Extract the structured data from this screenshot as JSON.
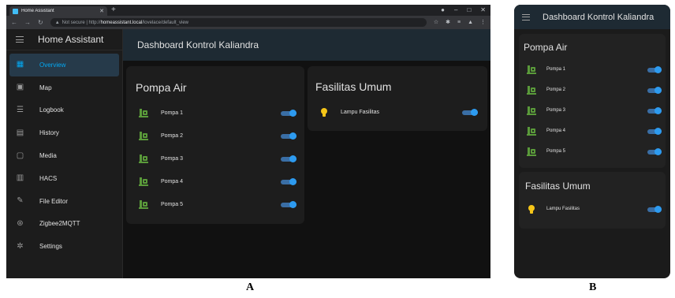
{
  "browser": {
    "tab_title": "Home Assistant",
    "url_scheme": "Not secure | http://",
    "url_host": "homeassistant.local",
    "url_path": "/lovelace/default_view"
  },
  "sidebar": {
    "app_title": "Home Assistant",
    "items": [
      {
        "label": "Overview",
        "icon": "view-dashboard-icon",
        "active": true
      },
      {
        "label": "Map",
        "icon": "map-icon"
      },
      {
        "label": "Logbook",
        "icon": "logbook-icon"
      },
      {
        "label": "History",
        "icon": "history-chart-icon"
      },
      {
        "label": "Media",
        "icon": "media-icon"
      },
      {
        "label": "HACS",
        "icon": "hacs-store-icon"
      },
      {
        "label": "File Editor",
        "icon": "wrench-icon"
      },
      {
        "label": "Zigbee2MQTT",
        "icon": "zigbee-icon"
      },
      {
        "label": "Settings",
        "icon": "gear-icon"
      }
    ]
  },
  "dashboard": {
    "title": "Dashboard Kontrol Kaliandra",
    "pompa_card": {
      "title": "Pompa Air",
      "rows": [
        "Pompa 1",
        "Pompa 2",
        "Pompa 3",
        "Pompa 4",
        "Pompa 5"
      ]
    },
    "fasilitas_card": {
      "title": "Fasilitas Umum",
      "rows": [
        "Lampu Fasilitas"
      ]
    },
    "switch_states": "on"
  },
  "captions": {
    "a": "A",
    "b": "B"
  },
  "colors": {
    "accent": "#03a9f4",
    "toggle_on": "#2d9bf0",
    "header_bg": "#1e2a33",
    "pump_icon": "#5a9a3a",
    "bulb_icon": "#f5c518"
  }
}
